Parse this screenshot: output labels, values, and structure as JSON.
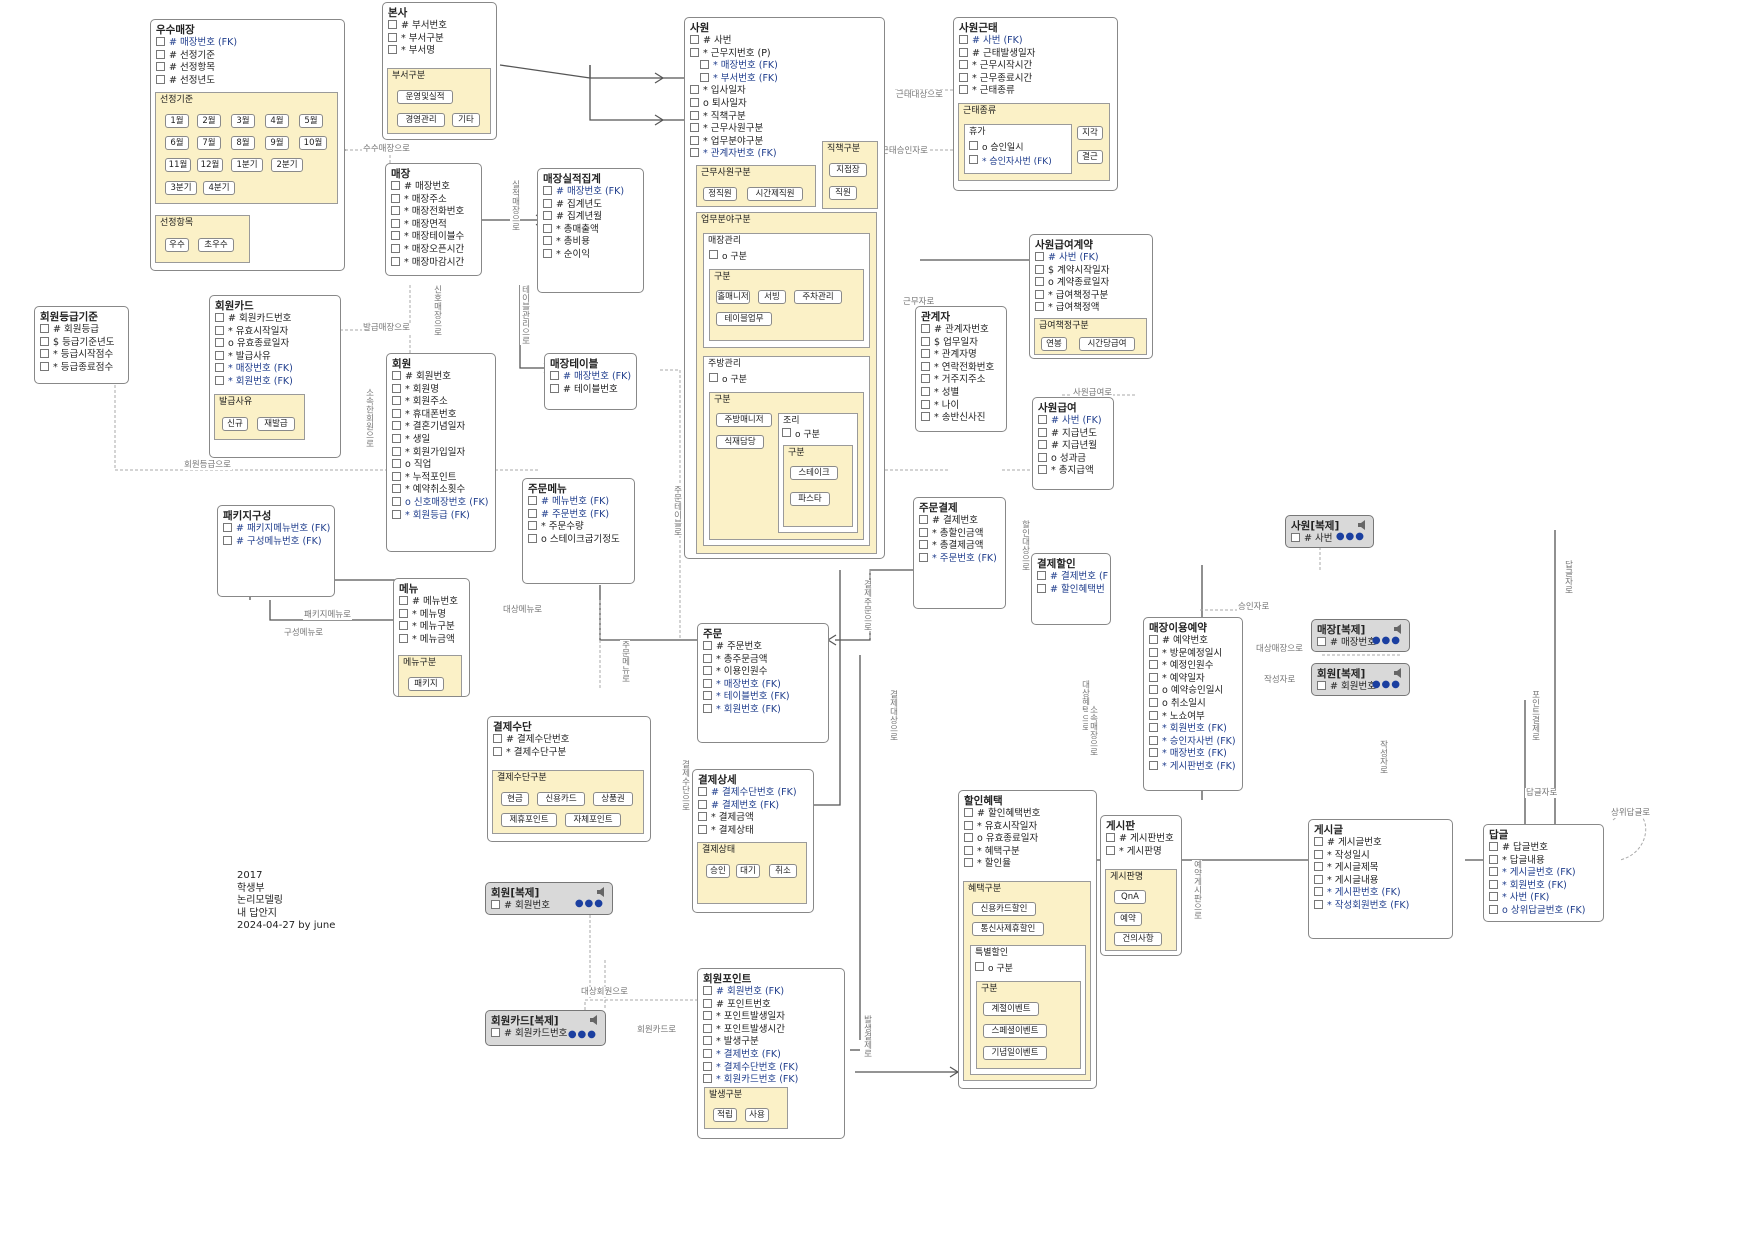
{
  "note": {
    "year": "2017",
    "line1": "학생부",
    "line2": "논리모델링",
    "line3": "내 답안지",
    "line4": "2024-04-27 by june"
  },
  "entities": {
    "excellent_store": {
      "title": "우수매장",
      "attrs": [
        "# 매장번호 (FK)",
        "# 선정기준",
        "# 선정항목",
        "# 선정년도"
      ],
      "selection_criteria": {
        "title": "선정기준",
        "chips": [
          "1월",
          "2월",
          "3월",
          "4월",
          "5월",
          "6월",
          "7월",
          "8월",
          "9월",
          "10월",
          "11월",
          "12월",
          "1분기",
          "2분기",
          "3분기",
          "4분기"
        ]
      },
      "selection_item": {
        "title": "선정항목",
        "chips": [
          "우수",
          "초우수"
        ]
      }
    },
    "head_office": {
      "title": "본사",
      "attrs": [
        "# 부서번호",
        "* 부서구분",
        "* 부서명"
      ],
      "dept_type": {
        "title": "부서구분",
        "chips": [
          "운영및실적",
          "경영관리",
          "기타"
        ]
      }
    },
    "store": {
      "title": "매장",
      "attrs": [
        "# 매장번호",
        "* 매장주소",
        "* 매장전화번호",
        "* 매장면적",
        "* 매장테이블수",
        "* 매장오픈시간",
        "* 매장마감시간"
      ]
    },
    "store_performance": {
      "title": "매장실적집계",
      "attrs": [
        "# 매장번호 (FK)",
        "# 집계년도",
        "# 집계년월",
        "* 총매출액",
        "* 총비용",
        "* 순이익"
      ]
    },
    "store_table": {
      "title": "매장테이블",
      "attrs": [
        "# 매장번호 (FK)",
        "# 테이블번호"
      ]
    },
    "member_grade": {
      "title": "회원등급기준",
      "attrs": [
        "# 회원등급",
        "$ 등급기준년도",
        "* 등급시작점수",
        "* 등급종료점수"
      ]
    },
    "member_card": {
      "title": "회원카드",
      "attrs": [
        "# 회원카드번호",
        "* 유효시작일자",
        "o 유효종료일자",
        "* 발급사유",
        "* 매장번호 (FK)",
        "* 회원번호 (FK)"
      ],
      "issue_reason": {
        "title": "발급사유",
        "chips": [
          "신규",
          "재발급"
        ]
      }
    },
    "member": {
      "title": "회원",
      "attrs": [
        "# 회원번호",
        "* 회원명",
        "* 회원주소",
        "* 휴대폰번호",
        "* 결혼기념일자",
        "* 생일",
        "* 회원가입일자",
        "o 직업",
        "* 누적포인트",
        "* 예약취소횟수",
        "o 신호매장번호 (FK)",
        "* 회원등급 (FK)"
      ]
    },
    "package": {
      "title": "패키지구성",
      "attrs": [
        "# 패키지메뉴번호 (FK)",
        "# 구성메뉴번호 (FK)"
      ]
    },
    "menu": {
      "title": "메뉴",
      "attrs": [
        "# 메뉴번호",
        "* 메뉴명",
        "* 메뉴구분",
        "* 메뉴금액"
      ],
      "menu_type": {
        "title": "메뉴구분",
        "chips": [
          "패키지",
          "단품"
        ]
      }
    },
    "order_menu": {
      "title": "주문메뉴",
      "attrs": [
        "# 메뉴번호 (FK)",
        "# 주문번호 (FK)",
        "* 주문수량",
        "o 스테이크굽기정도"
      ]
    },
    "order": {
      "title": "주문",
      "attrs": [
        "# 주문번호",
        "* 총주문금액",
        "* 이용인원수",
        "* 매장번호 (FK)",
        "* 테이블번호 (FK)",
        "* 회원번호 (FK)"
      ]
    },
    "payment_method": {
      "title": "결제수단",
      "attrs": [
        "# 결제수단번호",
        "* 결제수단구분"
      ],
      "method_type": {
        "title": "결제수단구분",
        "chips": [
          "현금",
          "신용카드",
          "상품권",
          "제휴포인트",
          "자체포인트"
        ]
      }
    },
    "payment_detail": {
      "title": "결제상세",
      "attrs": [
        "# 결제수단번호 (FK)",
        "# 결제번호 (FK)",
        "* 결제금액",
        "* 결제상태"
      ],
      "pay_status": {
        "title": "결제상태",
        "chips": [
          "승인",
          "대기",
          "취소"
        ]
      }
    },
    "employee": {
      "title": "사원",
      "attrs": [
        "# 사번",
        "* 근무지번호 (P)",
        "* 매장번호 (FK)",
        "* 부서번호 (FK)",
        "* 입사일자",
        "o 퇴사일자",
        "* 직책구분",
        "* 근무사원구분",
        "* 업무분야구분",
        "* 관계자번호 (FK)"
      ],
      "work_type": {
        "title": "근무사원구분",
        "chips": [
          "정직원",
          "시간제직원"
        ]
      },
      "position": {
        "title": "직책구분",
        "chips": [
          "지점장",
          "직원"
        ]
      },
      "field": {
        "title": "업무분야구분",
        "store_mgmt": {
          "title": "매장관리",
          "attr": "o 구분",
          "sub_title": "구분",
          "chips": [
            "홀매니저",
            "서빙",
            "주차관리",
            "테이블업무"
          ]
        },
        "kitchen": {
          "title": "주방관리",
          "attr": "o 구분",
          "sub_title": "구분",
          "chips": [
            "주방매니저",
            "식재담당"
          ],
          "cook": {
            "title": "조리",
            "attr": "o 구분",
            "sub_title": "구분",
            "chips": [
              "스테이크",
              "파스타"
            ]
          }
        }
      }
    },
    "employee_attendance": {
      "title": "사원근태",
      "attrs": [
        "# 사번 (FK)",
        "# 근태발생일자",
        "* 근무시작시간",
        "* 근무종료시간",
        "* 근태종류"
      ],
      "kind": {
        "title": "근태종류",
        "vacation": {
          "title": "휴가",
          "attrs": [
            "o 승인일시",
            "* 승인자사번 (FK)"
          ]
        },
        "chips": [
          "지각",
          "결근"
        ]
      }
    },
    "salary_contract": {
      "title": "사원급여계약",
      "attrs": [
        "# 사번 (FK)",
        "$ 계약시작일자",
        "o 계약종료일자",
        "* 급여책정구분",
        "* 급여책정액"
      ],
      "pay_type": {
        "title": "급여책정구분",
        "chips": [
          "연봉",
          "시간당급여"
        ]
      }
    },
    "related_party": {
      "title": "관계자",
      "attrs": [
        "# 관계자번호",
        "$ 업무일자",
        "* 관계자명",
        "* 연락전화번호",
        "* 거주지주소",
        "* 성별",
        "* 나이",
        "* 송반신사진"
      ]
    },
    "employee_salary": {
      "title": "사원급여",
      "attrs": [
        "# 사번 (FK)",
        "# 지급년도",
        "# 지급년월",
        "o 성과금",
        "* 총지급액"
      ]
    },
    "order_payment": {
      "title": "주문결제",
      "attrs": [
        "# 결제번호",
        "* 총할인금액",
        "* 총결제금액",
        "* 주문번호 (FK)"
      ]
    },
    "payment_discount": {
      "title": "결제할인",
      "attrs": [
        "# 결제번호 (F",
        "# 할인혜택번"
      ]
    },
    "discount_benefit": {
      "title": "할인혜택",
      "attrs": [
        "# 할인혜택번호",
        "* 유효시작일자",
        "o 유효종료일자",
        "* 혜택구분",
        "* 할인율"
      ],
      "benefit_type": {
        "title": "혜택구분",
        "chips": [
          "신용카드할인",
          "통신사제휴할인"
        ],
        "special": {
          "title": "특별할인",
          "attr": "o 구분",
          "sub_title": "구분",
          "chips": [
            "계절이벤트",
            "스페셜이벤트",
            "기념일이벤트"
          ]
        }
      }
    },
    "member_point": {
      "title": "회원포인트",
      "attrs": [
        "# 회원번호 (FK)",
        "# 포인트번호",
        "* 포인트발생일자",
        "* 포인트발생시간",
        "* 발생구분",
        "* 결제번호 (FK)",
        "* 결제수단번호 (FK)",
        "* 회원카드번호 (FK)"
      ],
      "occur_type": {
        "title": "발생구분",
        "chips": [
          "적립",
          "사용"
        ]
      }
    },
    "member_copy": {
      "title": "회원[복제]",
      "attrs": [
        "# 회원번호"
      ]
    },
    "member_card_copy": {
      "title": "회원카드[복제]",
      "attrs": [
        "# 회원카드번호"
      ]
    },
    "employee_copy": {
      "title": "사원[복제]",
      "attrs": [
        "# 사번"
      ]
    },
    "store_copy": {
      "title": "매장[복제]",
      "attrs": [
        "# 매장번호"
      ]
    },
    "member_copy2": {
      "title": "회원[복제]",
      "attrs": [
        "# 회원번호"
      ]
    },
    "reservation": {
      "title": "매장이용예약",
      "attrs": [
        "# 예약번호",
        "* 방문예정일시",
        "* 예정인원수",
        "* 예약일자",
        "o 예약승인일시",
        "o 취소일시",
        "* 노쇼여부",
        "* 회원번호 (FK)",
        "* 승인자사번 (FK)",
        "* 매장번호 (FK)",
        "* 게시판번호 (FK)"
      ]
    },
    "board": {
      "title": "게시판",
      "attrs": [
        "# 게시판번호",
        "* 게시판명"
      ],
      "board_name": {
        "title": "게시판명",
        "chips": [
          "QnA",
          "예약",
          "건의사항"
        ]
      }
    },
    "post": {
      "title": "게시글",
      "attrs": [
        "# 게시글번호",
        "* 작성일시",
        "* 게시글제목",
        "* 게시글내용",
        "* 게시판번호 (FK)",
        "* 작성회원번호 (FK)"
      ]
    },
    "reply": {
      "title": "답글",
      "attrs": [
        "# 답글번호",
        "* 답글내용",
        "* 게시글번호 (FK)",
        "* 회원번호 (FK)",
        "* 사번 (FK)",
        "o 상위답글번호 (FK)"
      ]
    }
  },
  "relations": {
    "r1": "수수매장으로",
    "r2": "발급매장으로",
    "r3": "회원등급으로",
    "r4": "소속한회원으로",
    "r5": "신호매장으로",
    "r6": "테이블관리으로",
    "r7": "실적매장으로",
    "r8": "패키지메뉴로",
    "r9": "구성메뉴로",
    "r10": "대상메뉴로",
    "r11": "주문메뉴로",
    "r12": "주문테이블로",
    "r13": "결제수단으로",
    "r14": "결제주문으로",
    "r15": "결제대상으로",
    "r16": "대상회원으로",
    "r17": "회원카드로",
    "r18": "발생결제로",
    "r19": "근태대상으로",
    "r20": "근태승인자로",
    "r21": "근무자로",
    "r22": "사원급여로",
    "r23": "할인대상으로",
    "r24": "대상혜택으로",
    "r25": "승인자로",
    "r26": "대상매장으로",
    "r27": "작성자로",
    "r28": "작성자로",
    "r29": "답글자로",
    "r30": "상위답글로",
    "r31": "예약게시판으로",
    "r32": "소속매장으로",
    "r33": "답글자로",
    "r34": "포인트결제로"
  },
  "colors": {
    "group_fill": "#fbf1c7",
    "fk_text": "#1f3d8c",
    "copy_fill": "#d9d9d9",
    "line": "#555555",
    "dashed": "#aaaaaa"
  }
}
